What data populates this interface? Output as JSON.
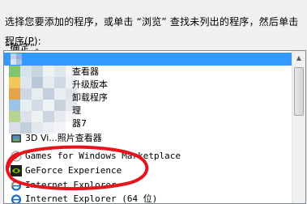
{
  "instruction": {
    "line1": "选择您要添加的程序，或单击 “浏览” 查找未列出的程序，然后单击",
    "line2": "“确定”。"
  },
  "list": {
    "label": "程序(P):",
    "items": [
      {
        "label": "",
        "icon": "pixelated-icon",
        "selected": true
      },
      {
        "label": "查看器",
        "icon": "pixelated-icon",
        "selected": false
      },
      {
        "label": "升级版本",
        "icon": "pixelated-icon",
        "selected": false
      },
      {
        "label": "卸载程序",
        "icon": "pixelated-icon",
        "selected": false
      },
      {
        "label": "理",
        "icon": "pixelated-icon",
        "selected": false
      },
      {
        "label": "器7",
        "icon": "pixelated-icon",
        "selected": false
      },
      {
        "label": "3D Vi...照片查看器",
        "icon": "photo-viewer-icon",
        "selected": false
      },
      {
        "label": "Games for Windows Marketplace",
        "icon": "games-marketplace-icon",
        "selected": false
      },
      {
        "label": "GeForce Experience",
        "icon": "geforce-icon",
        "selected": false
      },
      {
        "label": "Internet Explorer",
        "icon": "internet-explorer-icon",
        "selected": false
      },
      {
        "label": "Internet Explorer (64 位)",
        "icon": "internet-explorer-icon",
        "selected": false
      }
    ]
  },
  "colors": {
    "selection": "#3399ff",
    "annotation_circle": "#e8141c",
    "geforce_green": "#76b900",
    "ie_blue": "#1a6fc4"
  }
}
